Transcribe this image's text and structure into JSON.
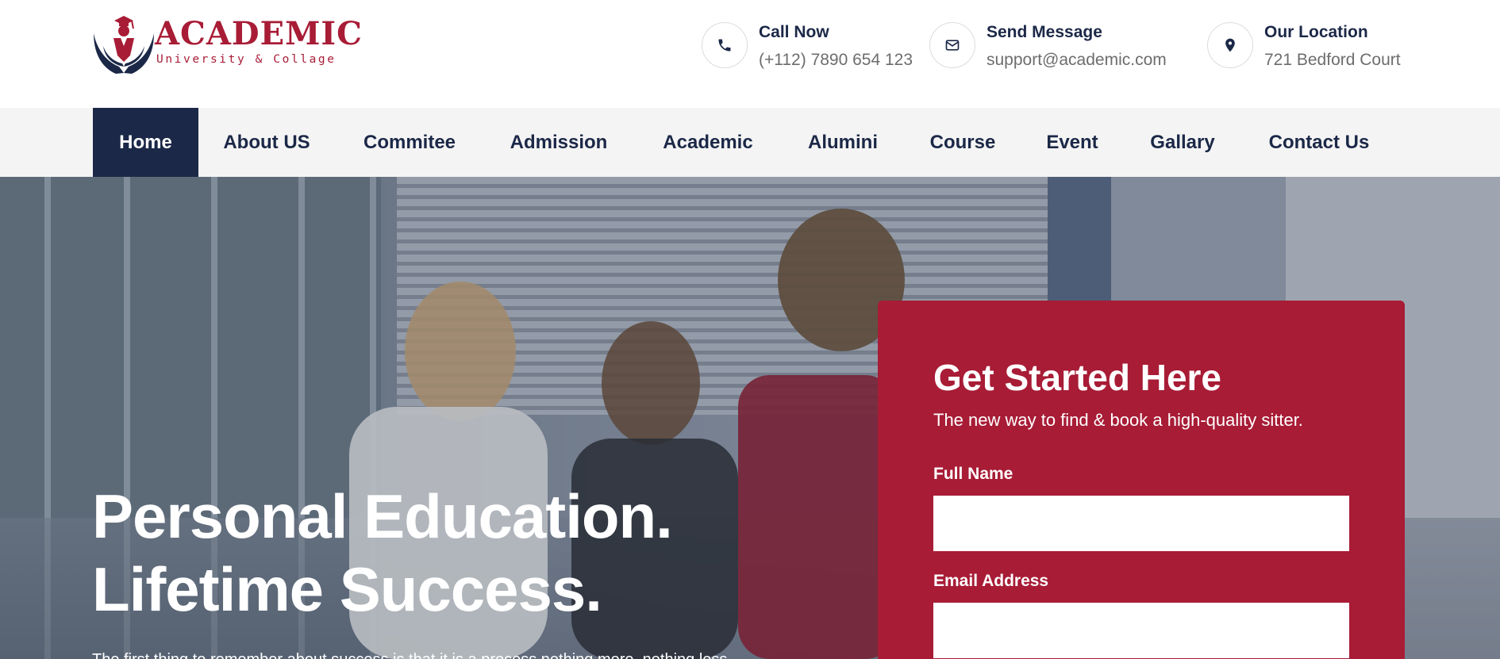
{
  "brand": {
    "name": "ACADEMIC",
    "tagline": "University & Collage",
    "icon": "graduate-hands-logo",
    "color": "#a81c36",
    "navy": "#1b2847"
  },
  "contacts": [
    {
      "icon": "phone-icon",
      "title": "Call Now",
      "value": "(+112) 7890 654 123"
    },
    {
      "icon": "envelope-icon",
      "title": "Send Message",
      "value": "support@academic.com"
    },
    {
      "icon": "location-pin-icon",
      "title": "Our Location",
      "value": "721 Bedford Court"
    }
  ],
  "nav": {
    "active": "Home",
    "items": [
      "Home",
      "About US",
      "Commitee",
      "Admission",
      "Academic",
      "Alumini",
      "Course",
      "Event",
      "Gallary",
      "Contact Us"
    ]
  },
  "hero": {
    "title_line1": "Personal Education.",
    "title_line2": "Lifetime Success.",
    "description": "The first thing to remember about success is that it is a process nothing more, nothing less."
  },
  "form": {
    "title": "Get Started Here",
    "subtitle": "The new way to find & book a high-quality sitter.",
    "fields": [
      {
        "label": "Full Name",
        "value": "",
        "placeholder": ""
      },
      {
        "label": "Email Address",
        "value": "",
        "placeholder": ""
      }
    ]
  }
}
